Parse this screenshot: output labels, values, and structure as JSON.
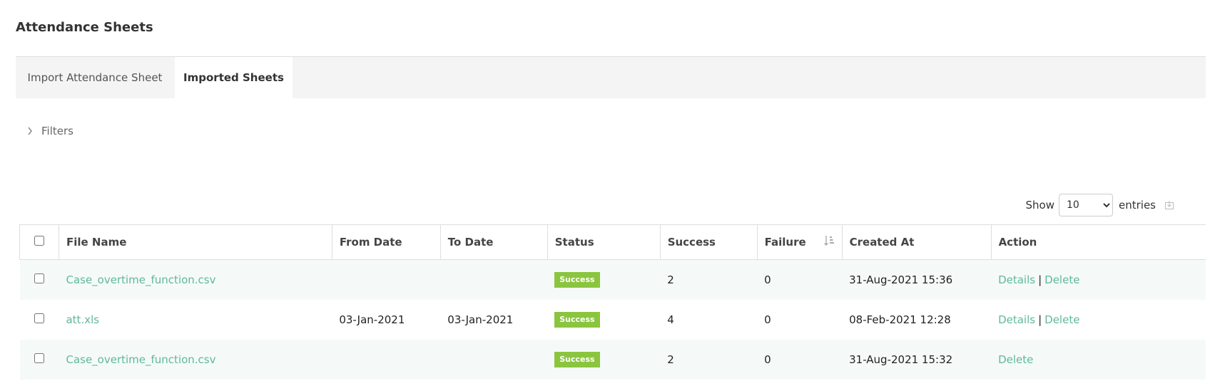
{
  "page": {
    "title": "Attendance Sheets"
  },
  "tabs": [
    {
      "label": "Import Attendance Sheet",
      "active": false
    },
    {
      "label": "Imported Sheets",
      "active": true
    }
  ],
  "filters": {
    "label": "Filters",
    "icon": "chevron-right-icon"
  },
  "entries": {
    "show_label": "Show",
    "selected": "10",
    "entries_label": "entries",
    "export_icon": "export-icon"
  },
  "table": {
    "columns": [
      "File Name",
      "From Date",
      "To Date",
      "Status",
      "Success",
      "Failure",
      "Created At",
      "Action"
    ],
    "sort_icon": "sort-amount-icon",
    "rows": [
      {
        "file_name": "Case_overtime_function.csv",
        "from_date": "",
        "to_date": "",
        "status": "Success",
        "success": "2",
        "failure": "0",
        "created_at": "31-Aug-2021 15:36",
        "actions": [
          "Details",
          "Delete"
        ]
      },
      {
        "file_name": "att.xls",
        "from_date": "03-Jan-2021",
        "to_date": "03-Jan-2021",
        "status": "Success",
        "success": "4",
        "failure": "0",
        "created_at": "08-Feb-2021 12:28",
        "actions": [
          "Details",
          "Delete"
        ]
      },
      {
        "file_name": "Case_overtime_function.csv",
        "from_date": "",
        "to_date": "",
        "status": "Success",
        "success": "2",
        "failure": "0",
        "created_at": "31-Aug-2021 15:32",
        "actions": [
          "Delete"
        ]
      }
    ]
  },
  "colors": {
    "link": "#5fb89c",
    "success_badge": "#8bc53f",
    "row_stripe": "#f5faf8",
    "tab_bar": "#f4f4f4"
  }
}
